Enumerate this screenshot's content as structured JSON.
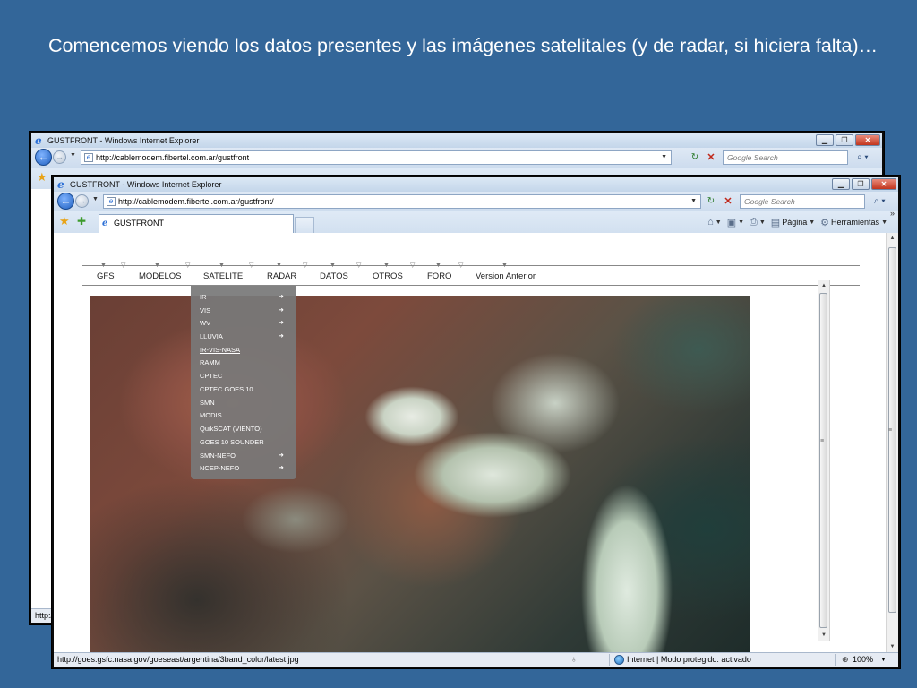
{
  "slide": {
    "title": "Comencemos viendo los datos presentes y las imágenes satelitales (y de radar, si hiciera falta)…"
  },
  "browser_back": {
    "window_title": "GUSTFRONT - Windows Internet Explorer",
    "address": "http://cablemodem.fibertel.com.ar/gustfront",
    "search_placeholder": "Google Search",
    "status_url": "http:/"
  },
  "browser": {
    "window_title": "GUSTFRONT - Windows Internet Explorer",
    "address": "http://cablemodem.fibertel.com.ar/gustfront/",
    "search_placeholder": "Google Search",
    "tab_title": "GUSTFRONT",
    "command_bar": {
      "page_label": "Página",
      "tools_label": "Herramientas"
    },
    "status": {
      "url": "http://goes.gsfc.nasa.gov/goeseast/argentina/3band_color/latest.jpg",
      "zone": "Internet | Modo protegido: activado",
      "zoom": "100%"
    }
  },
  "site_menu": {
    "items": [
      "GFS",
      "MODELOS",
      "SATELITE",
      "RADAR",
      "DATOS",
      "OTROS",
      "FORO",
      "Version Anterior"
    ],
    "active": "SATELITE"
  },
  "satellite_dropdown": {
    "items": [
      {
        "label": "IR",
        "submenu": true
      },
      {
        "label": "VIS",
        "submenu": true
      },
      {
        "label": "WV",
        "submenu": true
      },
      {
        "label": "LLUVIA",
        "submenu": true
      },
      {
        "label": "IR-VIS-NASA",
        "submenu": false,
        "hovered": true
      },
      {
        "label": "RAMM",
        "submenu": false
      },
      {
        "label": "CPTEC",
        "submenu": false
      },
      {
        "label": "CPTEC GOES 10",
        "submenu": false
      },
      {
        "label": "SMN",
        "submenu": false
      },
      {
        "label": "MODIS",
        "submenu": false
      },
      {
        "label": "QuikSCAT (VIENTO)",
        "submenu": false
      },
      {
        "label": "GOES 10 SOUNDER",
        "submenu": false
      },
      {
        "label": "SMN-NEFO",
        "submenu": true
      },
      {
        "label": "NCEP-NEFO",
        "submenu": true
      }
    ]
  },
  "icons": {
    "ie_logo": "e",
    "back": "back-arrow-icon",
    "forward": "forward-arrow-icon",
    "refresh": "refresh-icon",
    "stop": "stop-icon",
    "search": "magnifier-icon",
    "favorites": "star-icon",
    "add_favorites": "add-favorites-icon",
    "home": "home-icon",
    "feeds": "feeds-icon",
    "print": "print-icon",
    "page": "page-icon",
    "tools": "gear-icon"
  },
  "colors": {
    "slide_background": "#336699",
    "slide_text": "#ffffff",
    "dropdown_bg": "#787878"
  }
}
